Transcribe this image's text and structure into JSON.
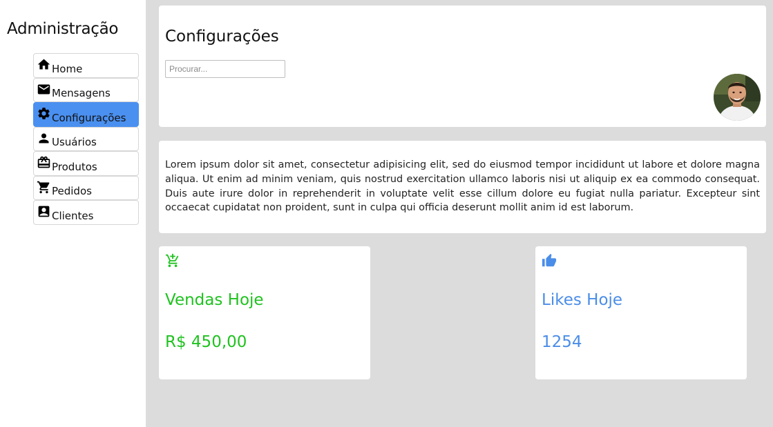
{
  "brand": {
    "title": "Administração"
  },
  "nav": {
    "items": [
      {
        "label": "Home",
        "icon": "home-icon",
        "active": false
      },
      {
        "label": "Mensagens",
        "icon": "mail-icon",
        "active": false
      },
      {
        "label": "Configurações",
        "icon": "gear-icon",
        "active": true
      },
      {
        "label": "Usuários",
        "icon": "user-icon",
        "active": false
      },
      {
        "label": "Produtos",
        "icon": "gift-icon",
        "active": false
      },
      {
        "label": "Pedidos",
        "icon": "cart-icon",
        "active": false
      },
      {
        "label": "Clientes",
        "icon": "contact-card-icon",
        "active": false
      }
    ]
  },
  "header": {
    "title": "Configurações",
    "search_placeholder": "Procurar...",
    "search_value": ""
  },
  "content": {
    "paragraph": "Lorem ipsum dolor sit amet, consectetur adipisicing elit, sed do eiusmod tempor incididunt ut labore et dolore magna aliqua. Ut enim ad minim veniam, quis nostrud exercitation ullamco laboris nisi ut aliquip ex ea commodo consequat. Duis aute irure dolor in reprehenderit in voluptate velit esse cillum dolore eu fugiat nulla pariatur. Excepteur sint occaecat cupidatat non proident, sunt in culpa qui officia deserunt mollit anim id est laborum."
  },
  "stats": {
    "sales": {
      "icon": "add-shopping-cart-icon",
      "label": "Vendas Hoje",
      "value": "R$ 450,00",
      "color": "#1fc21f"
    },
    "likes": {
      "icon": "thumbs-up-icon",
      "label": "Likes Hoje",
      "value": "1254",
      "color": "#4a8de8"
    }
  },
  "colors": {
    "accent": "#4a90f0",
    "background": "#dcdcdc",
    "card": "#ffffff"
  }
}
